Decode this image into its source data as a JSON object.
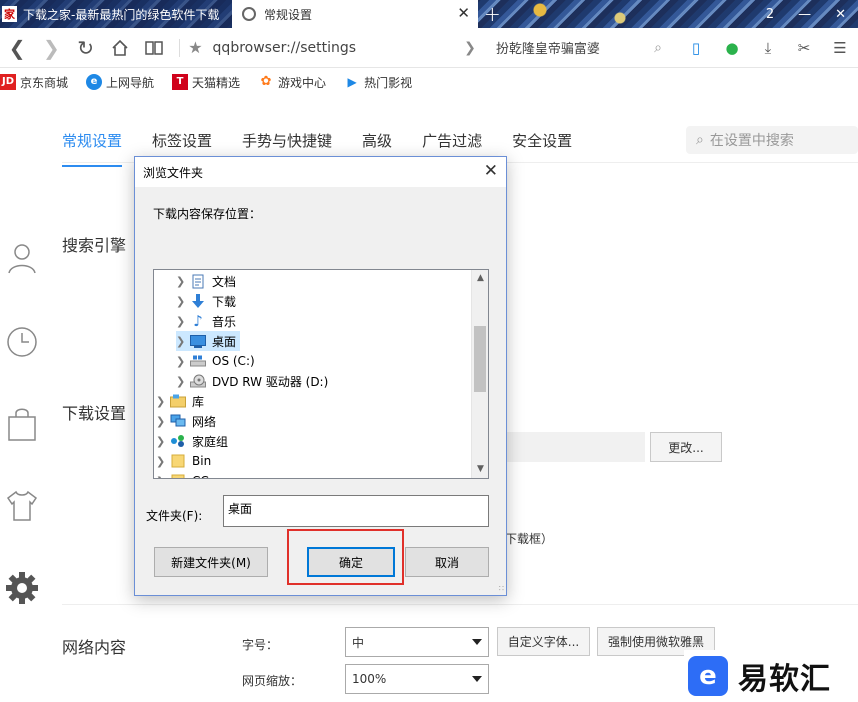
{
  "browser": {
    "tabs": [
      {
        "label": "下载之家-最新最热门的绿色软件下载",
        "logo": "家"
      },
      {
        "label": "常规设置"
      }
    ],
    "window_controls": {
      "count": "2",
      "minimize": "—",
      "close": "✕"
    },
    "url": "qqbrowser://settings",
    "search_hint": "扮乾隆皇帝骗富婆",
    "bookmarks": [
      {
        "label": "京东商城",
        "icon_text": "JD",
        "color": "#e02020"
      },
      {
        "label": "上网导航",
        "icon_text": "e",
        "color": "#1e88e5"
      },
      {
        "label": "天猫精选",
        "icon_text": "T",
        "color": "#d0021b"
      },
      {
        "label": "游戏中心",
        "icon_text": "✿",
        "color": "#ff7a1a"
      },
      {
        "label": "热门影视",
        "icon_text": "▶",
        "color": "#1e88e5"
      }
    ]
  },
  "settings": {
    "tabs": [
      "常规设置",
      "标签设置",
      "手势与快捷键",
      "高级",
      "广告过滤",
      "安全设置"
    ],
    "active_tab": "常规设置",
    "search_placeholder": "在设置中搜索",
    "sections": {
      "search_engine": "搜索引擎",
      "download": "下载设置",
      "web_content": "网络内容"
    },
    "download": {
      "change_button": "更改...",
      "note": "下载框）"
    },
    "web_content": {
      "font_size_label": "字号：",
      "font_size_value": "中",
      "custom_font_button": "自定义字体...",
      "force_yahei_button": "强制使用微软雅黑",
      "zoom_label": "网页缩放：",
      "zoom_value": "100%"
    }
  },
  "dialog": {
    "title": "浏览文件夹",
    "description": "下载内容保存位置：",
    "tree": [
      {
        "label": "文档",
        "icon": "document-icon",
        "level": 2
      },
      {
        "label": "下载",
        "icon": "download-icon",
        "level": 2
      },
      {
        "label": "音乐",
        "icon": "music-icon",
        "level": 2
      },
      {
        "label": "桌面",
        "icon": "desktop-icon",
        "level": 2,
        "selected": true
      },
      {
        "label": "OS (C:)",
        "icon": "drive-icon",
        "level": 2
      },
      {
        "label": "DVD RW 驱动器 (D:)",
        "icon": "dvd-icon",
        "level": 2
      },
      {
        "label": "库",
        "icon": "library-icon",
        "level": 1
      },
      {
        "label": "网络",
        "icon": "network-icon",
        "level": 1
      },
      {
        "label": "家庭组",
        "icon": "homegroup-icon",
        "level": 1
      },
      {
        "label": "Bin",
        "icon": "folder-icon",
        "level": 1
      },
      {
        "label": "CC",
        "icon": "folder-icon",
        "level": 1
      }
    ],
    "folder_label": "文件夹(F):",
    "folder_value": "桌面",
    "buttons": {
      "new_folder": "新建文件夹(M)",
      "ok": "确定",
      "cancel": "取消"
    }
  },
  "watermark": {
    "logo": "e",
    "text": "易软汇"
  }
}
